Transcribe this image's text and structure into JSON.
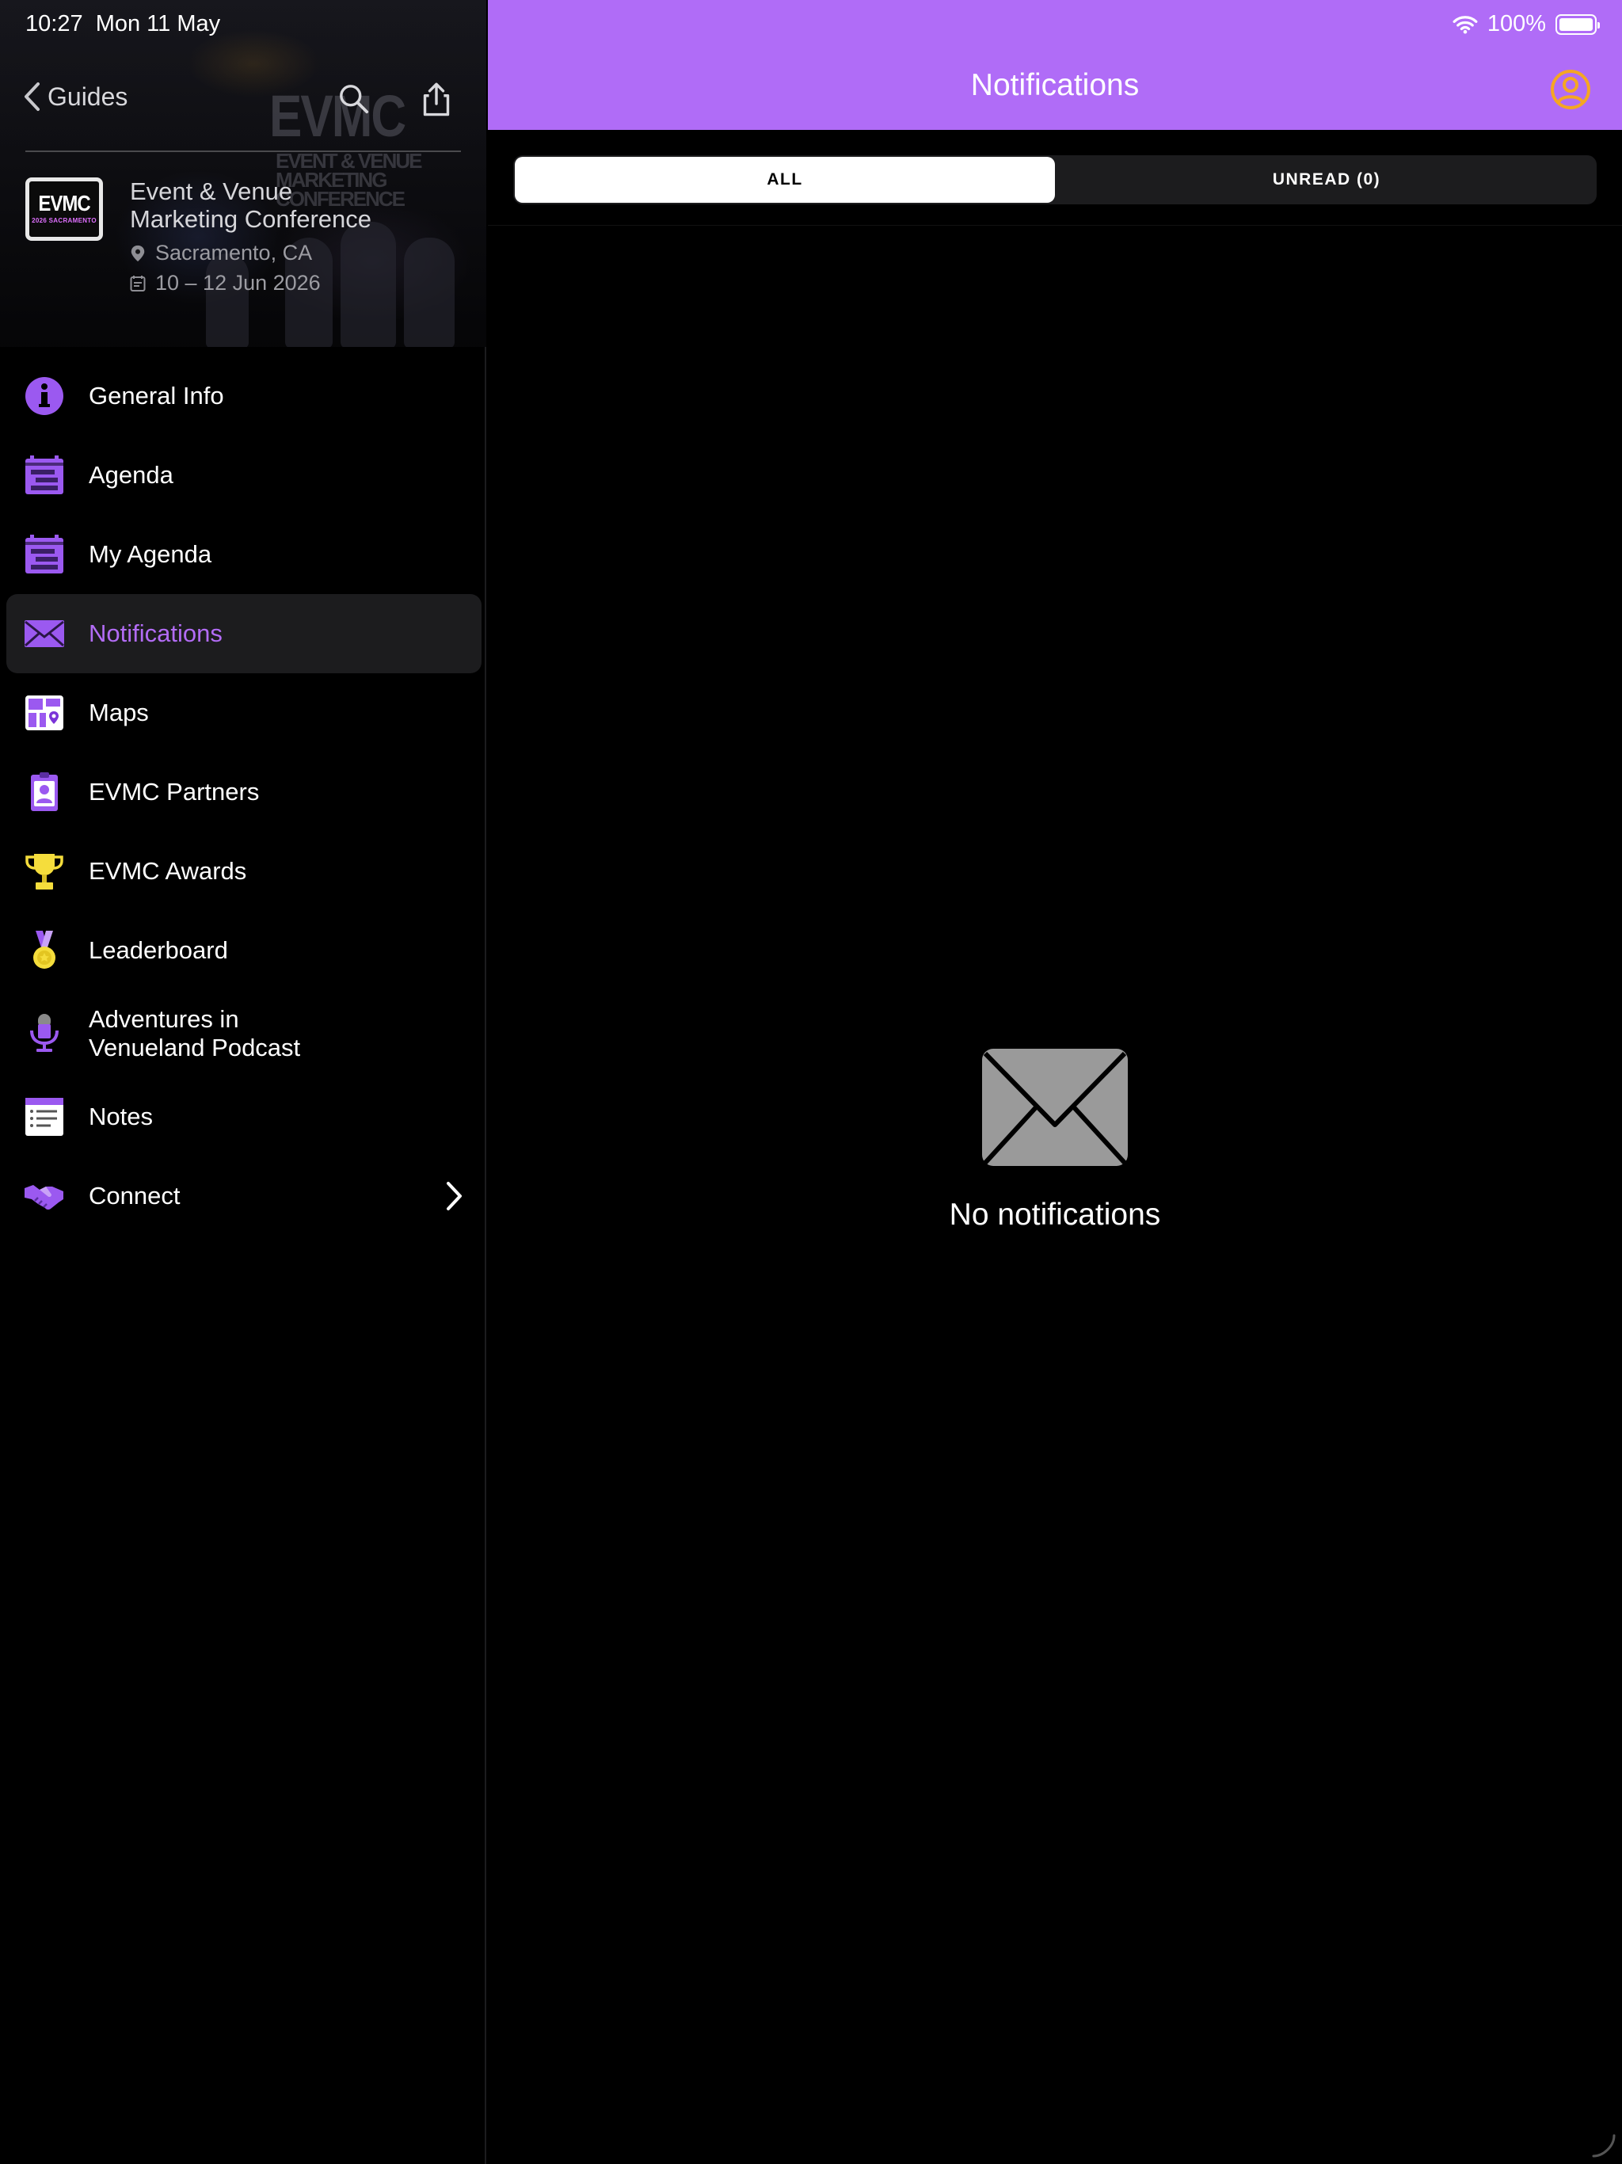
{
  "status_bar": {
    "time": "10:27",
    "date": "Mon 11 May",
    "battery": "100%",
    "wifi_icon": "wifi-icon",
    "battery_icon": "battery-icon"
  },
  "sidebar": {
    "back_label": "Guides",
    "search_icon": "search-icon",
    "share_icon": "share-icon",
    "event": {
      "logo_line1": "EVMC",
      "logo_line2": "2026 SACRAMENTO",
      "watermark_big": "EVMC",
      "watermark_line1": "EVENT & VENUE",
      "watermark_line2": "MARKETING CONFERENCE",
      "title_line1": "Event & Venue",
      "title_line2": "Marketing Conference",
      "location": "Sacramento, CA",
      "dates": "10 – 12 Jun 2026"
    },
    "items": [
      {
        "label": "General Info",
        "icon": "info-icon"
      },
      {
        "label": "Agenda",
        "icon": "agenda-icon"
      },
      {
        "label": "My Agenda",
        "icon": "my-agenda-icon"
      },
      {
        "label": "Notifications",
        "icon": "envelope-icon",
        "active": true
      },
      {
        "label": "Maps",
        "icon": "map-icon"
      },
      {
        "label": "EVMC Partners",
        "icon": "partner-badge-icon"
      },
      {
        "label": "EVMC Awards",
        "icon": "trophy-icon"
      },
      {
        "label": "Leaderboard",
        "icon": "medal-icon"
      },
      {
        "label_line1": "Adventures in",
        "label_line2": "Venueland Podcast",
        "icon": "podcast-icon"
      },
      {
        "label": "Notes",
        "icon": "notes-icon"
      },
      {
        "label": "Connect",
        "icon": "handshake-icon",
        "has_chevron": true
      }
    ]
  },
  "main": {
    "title": "Notifications",
    "profile_icon": "profile-icon",
    "tabs": [
      {
        "label": "ALL",
        "selected": true
      },
      {
        "label": "UNREAD (0)",
        "selected": false
      }
    ],
    "empty_state": {
      "icon": "envelope-icon",
      "text": "No notifications"
    }
  },
  "colors": {
    "accent": "#b06cf7",
    "accent_text": "#b26cf5",
    "profile_icon": "#f5a623",
    "background": "#000000",
    "active_row": "#1c1c1e",
    "empty_icon": "#9a9a9a"
  }
}
